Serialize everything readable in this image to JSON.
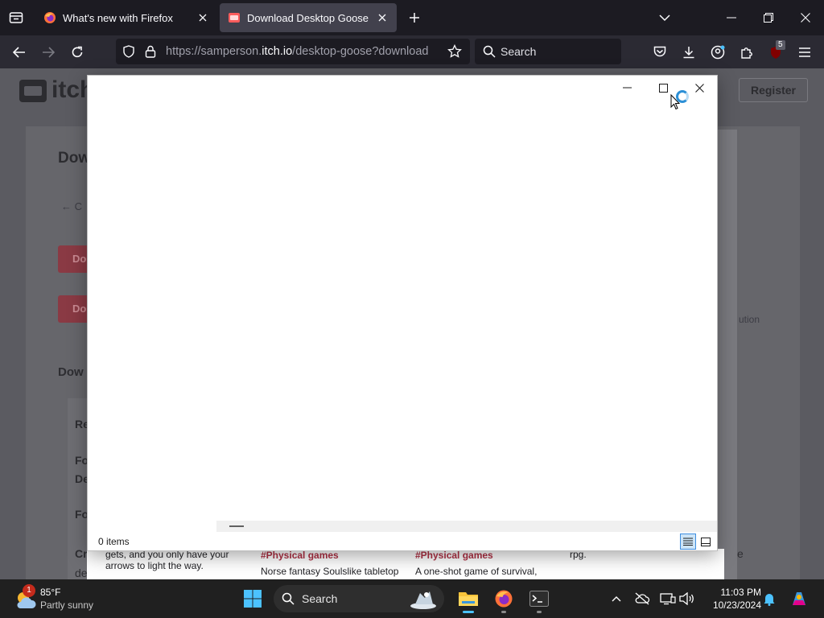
{
  "browser": {
    "tabs": [
      {
        "title": "What's new with Firefox",
        "active": false
      },
      {
        "title": "Download Desktop Goose by sa",
        "active": true
      }
    ],
    "url_prefix": "https://samperson.",
    "url_domain": "itch.io",
    "url_path": "/desktop-goose?download",
    "search_placeholder": "Search",
    "extension_badge": "5"
  },
  "page": {
    "logo_text": "itch",
    "register_label": "Register",
    "heading_fragment": "Dow",
    "back_fragment": "← C",
    "red_btn_fragment_1": "Do",
    "red_btn_fragment_2": "Do",
    "section_fragment": "Dow",
    "row_fragments": [
      "Re",
      "Fo",
      "De",
      "Fo",
      "Cr",
      "de"
    ],
    "side_fragment": "ution",
    "right_fragment": "e",
    "cards": [
      {
        "text_top": "gets, and you only have your",
        "text_bottom": "arrows to light the way."
      },
      {
        "tag": "#Physical games",
        "text": "Norse fantasy Soulslike tabletop"
      },
      {
        "tag": "#Physical games",
        "text": "A one-shot game of survival,"
      },
      {
        "text": "rpg."
      }
    ]
  },
  "window": {
    "status_text": "0 items"
  },
  "taskbar": {
    "weather_temp": "85°F",
    "weather_condition": "Partly sunny",
    "weather_badge": "1",
    "search_label": "Search",
    "time": "11:03 PM",
    "date": "10/23/2024"
  },
  "colors": {
    "accent_blue": "#2b8fd6",
    "itch_red": "#fa5c5c",
    "taskbar_active": "#4cc2ff"
  }
}
